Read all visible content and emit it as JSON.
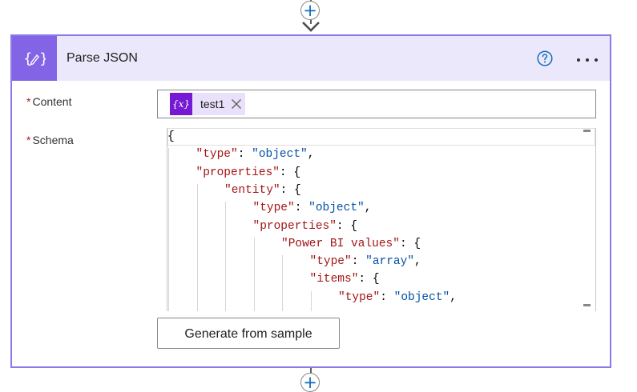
{
  "flow": {
    "top_add_symbol": "+",
    "bottom_add_symbol": "+"
  },
  "card": {
    "title": "Parse JSON",
    "action_icon": "braces-pencil-icon",
    "help_icon": "question-circle-icon",
    "more_icon": "more-dots-icon",
    "accent_color": "#8364e6",
    "header_bg": "#ece8fb"
  },
  "fields": {
    "content": {
      "required_mark": "*",
      "label": "Content",
      "token_symbol": "{x}",
      "token_label": "test1"
    },
    "schema": {
      "required_mark": "*",
      "label": "Schema",
      "lines": [
        {
          "indent": 0,
          "parts": [
            {
              "t": "p",
              "v": "{"
            }
          ]
        },
        {
          "indent": 1,
          "parts": [
            {
              "t": "k",
              "v": "\"type\""
            },
            {
              "t": "p",
              "v": ": "
            },
            {
              "t": "s",
              "v": "\"object\""
            },
            {
              "t": "p",
              "v": ","
            }
          ]
        },
        {
          "indent": 1,
          "parts": [
            {
              "t": "k",
              "v": "\"properties\""
            },
            {
              "t": "p",
              "v": ": {"
            }
          ]
        },
        {
          "indent": 2,
          "parts": [
            {
              "t": "k",
              "v": "\"entity\""
            },
            {
              "t": "p",
              "v": ": {"
            }
          ]
        },
        {
          "indent": 3,
          "parts": [
            {
              "t": "k",
              "v": "\"type\""
            },
            {
              "t": "p",
              "v": ": "
            },
            {
              "t": "s",
              "v": "\"object\""
            },
            {
              "t": "p",
              "v": ","
            }
          ]
        },
        {
          "indent": 3,
          "parts": [
            {
              "t": "k",
              "v": "\"properties\""
            },
            {
              "t": "p",
              "v": ": {"
            }
          ]
        },
        {
          "indent": 4,
          "parts": [
            {
              "t": "k",
              "v": "\"Power BI values\""
            },
            {
              "t": "p",
              "v": ": {"
            }
          ]
        },
        {
          "indent": 5,
          "parts": [
            {
              "t": "k",
              "v": "\"type\""
            },
            {
              "t": "p",
              "v": ": "
            },
            {
              "t": "s",
              "v": "\"array\""
            },
            {
              "t": "p",
              "v": ","
            }
          ]
        },
        {
          "indent": 5,
          "parts": [
            {
              "t": "k",
              "v": "\"items\""
            },
            {
              "t": "p",
              "v": ": {"
            }
          ]
        },
        {
          "indent": 6,
          "parts": [
            {
              "t": "k",
              "v": "\"type\""
            },
            {
              "t": "p",
              "v": ": "
            },
            {
              "t": "s",
              "v": "\"object\""
            },
            {
              "t": "p",
              "v": ","
            }
          ]
        }
      ]
    }
  },
  "buttons": {
    "generate_label": "Generate from sample"
  }
}
